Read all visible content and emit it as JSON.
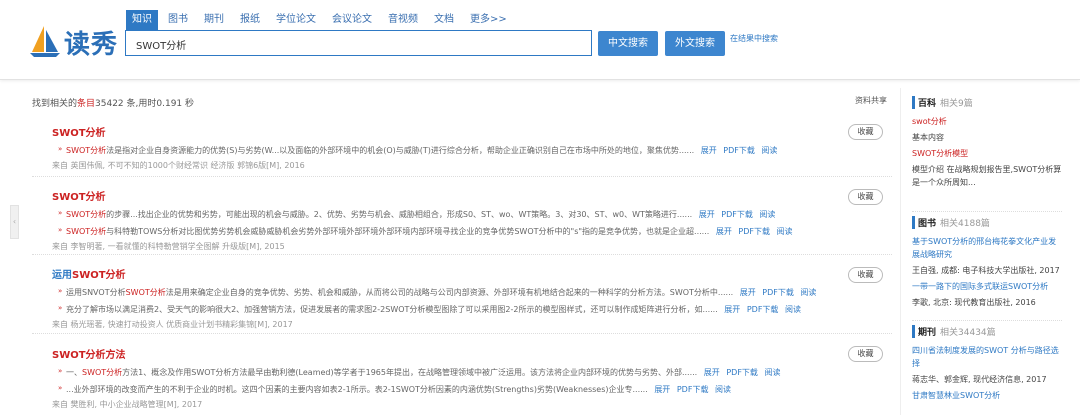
{
  "colors": {
    "accent": "#2e79c4",
    "highlight": "#cc2222"
  },
  "header": {
    "logo_text": "读秀",
    "tabs": [
      "知识",
      "图书",
      "期刊",
      "报纸",
      "学位论文",
      "会议论文",
      "音视频",
      "文档",
      "更多>>"
    ],
    "search_value": "SWOT分析",
    "btn_chinese": "中文搜索",
    "btn_foreign": "外文搜索",
    "in_results": "在结果中搜索"
  },
  "summary": {
    "prefix": "找到相关的",
    "entries": "条目",
    "count": "35422",
    "suffix": " 条,用时0.191 秒",
    "share": "资料共享"
  },
  "fav_label": "收藏",
  "results": [
    {
      "title": "SWOT分析",
      "lines": [
        {
          "kw": "SWOT分析",
          "text": "法是指对企业自身资源能力的优势(S)与劣势(W...以及面临的外部环境中的机会(O)与威胁(T)进行综合分析，帮助企业正确识别自己在市场中所处的地位，聚焦优势......",
          "links": [
            "展开",
            "PDF下载",
            "阅读"
          ]
        }
      ],
      "source": "来自 英国伟佩, 不可不知的1000个财经常识 经济版 郭锦6版[M], 2016"
    },
    {
      "title": "SWOT分析",
      "lines": [
        {
          "kw": "SWOT分析",
          "text": "的步骤...找出企业的优势和劣势，可能出现的机会与威胁。2、优势、劣势与机会、威胁相组合，形成S0、ST、wo、WT策略。3、对30、ST、w0、WT策略进行......",
          "links": [
            "展开",
            "PDF下载",
            "阅读"
          ]
        },
        {
          "kw": "SWOT分析",
          "text": "与科特勒TOWS分析对比图优势劣势机会威胁威胁机会劣势外部环境外部环境外部环境内部环境寻找企业的竞争优势SWOT分析中的\"s\"指的是竞争优势，也就是企业超......",
          "links": [
            "展开",
            "PDF下载",
            "阅读"
          ]
        }
      ],
      "source": "来自 李智明著, 一看就懂的科特勒营销学全图解 升级版[M], 2015"
    },
    {
      "title_prefix": "运用",
      "title": "SWOT分析",
      "lines": [
        {
          "pre": "运用SNVOT分析",
          "kw": "SWOT分析",
          "text": "法是用来确定企业自身的竞争优势、劣势、机会和威胁，从而将公司的战略与公司内部资源、外部环境有机地结合起来的一种科学的分析方法。SWOT分析中......",
          "links": [
            "展开",
            "PDF下载",
            "阅读"
          ]
        },
        {
          "pre": "",
          "kw": "",
          "text": "充分了解市场以满足消费2、受天气的影响很大2、加强营销方法，促进发展者的需求图2-2SWOT分析模型图除了可以采用图2-2所示的模型图样式，还可以制作成矩阵进行分析，如......",
          "links": [
            "展开",
            "PDF下载",
            "阅读"
          ]
        }
      ],
      "source": "来自 杨光瑶著, 快速打动投资人 优质商业计划书精彩集锦[M], 2017"
    },
    {
      "title": "SWOT分析方法",
      "lines": [
        {
          "pre": "一、",
          "kw": "SWOT分析",
          "text": "方法1、概念及作用SWOT分析方法最早由勒利德(Leamed)等学者于1965年提出，在战略管理领域中被广泛运用。该方法将企业内部环境的优势与劣势、外部......",
          "links": [
            "展开",
            "PDF下载",
            "阅读"
          ]
        },
        {
          "pre": "",
          "kw": "",
          "text": "...业外部环境的改变而产生的不利于企业的时机。这四个因素的主要内容如表2-1所示。表2-1SWOT分析因素的内涵优势(Strengths)劣势(Weaknesses)企业专......",
          "links": [
            "展开",
            "PDF下载",
            "阅读"
          ]
        }
      ],
      "source": "来自 樊胜利, 中小企业战略管理[M], 2017"
    }
  ],
  "sidebar": [
    {
      "head": "百科",
      "count": "相关9篇",
      "items": [
        {
          "text": "swot分析",
          "style": "red"
        },
        {
          "text": "基本内容",
          "style": "dark"
        },
        {
          "text": "SWOT分析模型",
          "style": "red"
        },
        {
          "text": "模型介绍      在战略规划报告里,SWOT分析算是一个众所周知...",
          "style": "dark"
        }
      ]
    },
    {
      "head": "图书",
      "count": "相关4188篇",
      "items": [
        {
          "text": "基于SWOT分析的邢台梅花拳文化产业发展战略研究",
          "style": "blue"
        },
        {
          "text": "王自强, 成都: 电子科技大学出版社, 2017",
          "style": "dark"
        },
        {
          "text": "一带一路下的国际多式联运SWOT分析",
          "style": "blue"
        },
        {
          "text": "李歌, 北京: 现代教育出版社, 2016",
          "style": "dark"
        }
      ]
    },
    {
      "head": "期刊",
      "count": "相关34434篇",
      "items": [
        {
          "text": "四川省法制度发展的SWOT 分析与路径选择",
          "style": "blue"
        },
        {
          "text": "蒋志华、郭金辉, 现代经济信息, 2017",
          "style": "dark"
        },
        {
          "text": "甘肃智慧林业SWOT分析",
          "style": "blue"
        }
      ]
    }
  ]
}
